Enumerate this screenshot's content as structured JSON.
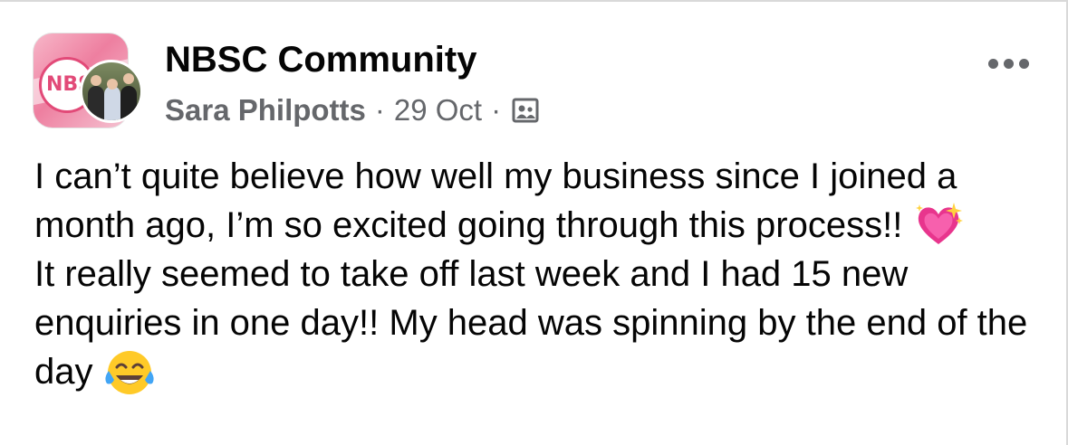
{
  "post": {
    "group_name": "NBSC Community",
    "author": "Sara Philpotts",
    "separator": "·",
    "date": "29 Oct",
    "privacy_icon": "group-members-icon",
    "more_icon": "more-options-icon",
    "body": {
      "line1": "I can’t quite believe how well my business since I joined a month ago, I’m so excited going through this process!!",
      "emoji1": "sparkling-heart-emoji",
      "line2": "It really seemed to take off last week and I had 15 new enquiries in one day!! My head was spinning by the end of the day",
      "emoji2": "tears-of-joy-emoji"
    },
    "avatar_badge_text": "NBS"
  },
  "colors": {
    "text_primary": "#050505",
    "text_secondary": "#65676b",
    "brand_pink": "#e24a78"
  }
}
